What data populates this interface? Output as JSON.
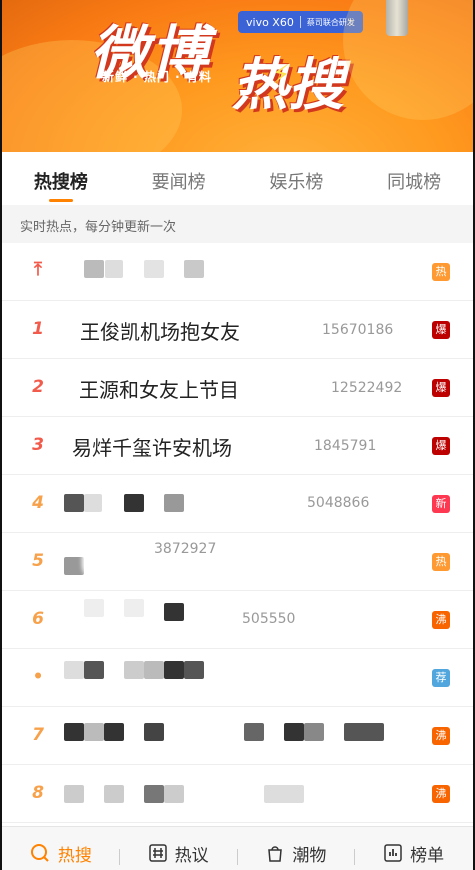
{
  "banner": {
    "title_part1": "微博",
    "title_part2": "热搜",
    "slogan": "新鲜 · 热门 · 有料",
    "sponsor": "vivo X60",
    "sponsor_sub": "蔡司联合研发"
  },
  "tabs": [
    {
      "label": "热搜榜",
      "active": true
    },
    {
      "label": "要闻榜",
      "active": false
    },
    {
      "label": "娱乐榜",
      "active": false
    },
    {
      "label": "同城榜",
      "active": false
    }
  ],
  "subheader": "实时热点，每分钟更新一次",
  "rows": [
    {
      "rank": "",
      "title": "",
      "count": "",
      "tag": "热",
      "tag_color": "#ff9a33"
    },
    {
      "rank": "1",
      "title": "王俊凯机场抱女友",
      "count": "15670186",
      "tag": "爆",
      "tag_color": "#bd0000"
    },
    {
      "rank": "2",
      "title": "王源和女友上节目",
      "count": "12522492",
      "tag": "爆",
      "tag_color": "#bd0000"
    },
    {
      "rank": "3",
      "title": "易烊千玺许安机场",
      "count": "1845791",
      "tag": "爆",
      "tag_color": "#bd0000"
    },
    {
      "rank": "4",
      "title": "",
      "count": "5048866",
      "tag": "新",
      "tag_color": "#ff3852"
    },
    {
      "rank": "5",
      "title": "",
      "count": "3872927",
      "tag": "热",
      "tag_color": "#ff9a33"
    },
    {
      "rank": "6",
      "title": "",
      "count": "505550",
      "tag": "沸",
      "tag_color": "#f86400"
    },
    {
      "rank": "•",
      "title": "",
      "count": "",
      "tag": "荐",
      "tag_color": "#50a6dd"
    },
    {
      "rank": "7",
      "title": "",
      "count": "",
      "tag": "沸",
      "tag_color": "#f86400"
    },
    {
      "rank": "8",
      "title": "",
      "count": "",
      "tag": "沸",
      "tag_color": "#f86400"
    }
  ],
  "bottom_nav": [
    {
      "label": "热搜",
      "icon": "search-icon",
      "active": true
    },
    {
      "label": "热议",
      "icon": "hashtag-icon",
      "active": false
    },
    {
      "label": "潮物",
      "icon": "bag-icon",
      "active": false
    },
    {
      "label": "榜单",
      "icon": "chart-icon",
      "active": false
    }
  ]
}
